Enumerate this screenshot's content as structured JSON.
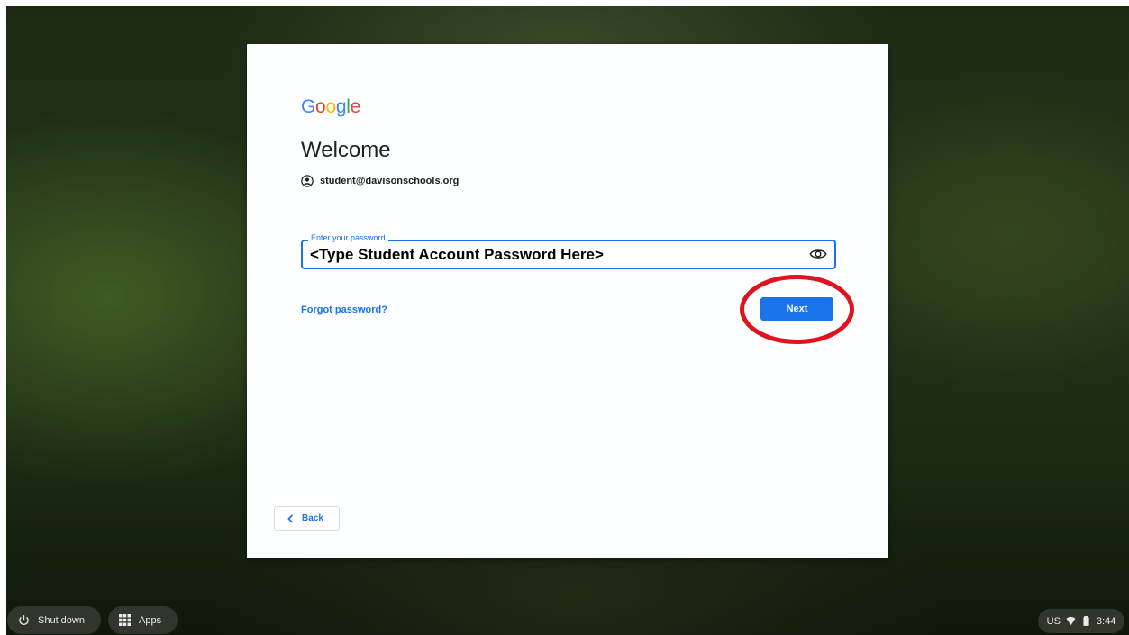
{
  "dialog": {
    "logo_parts": [
      "G",
      "o",
      "o",
      "g",
      "l",
      "e"
    ],
    "title": "Welcome",
    "account_email": "student@davisonschools.org",
    "password_label": "Enter your password",
    "password_value": "<Type Student Account Password Here>",
    "forgot_link": "Forgot password?",
    "next_label": "Next",
    "back_label": "Back"
  },
  "shelf": {
    "shutdown_label": "Shut down",
    "apps_label": "Apps"
  },
  "tray": {
    "keyboard": "US",
    "time": "3:44"
  },
  "colors": {
    "accent": "#1a73e8",
    "highlight_ring": "#e0141e"
  },
  "icons": [
    "account-circle-icon",
    "eye-icon",
    "chevron-left-icon",
    "power-icon",
    "apps-grid-icon",
    "wifi-icon",
    "battery-icon"
  ]
}
